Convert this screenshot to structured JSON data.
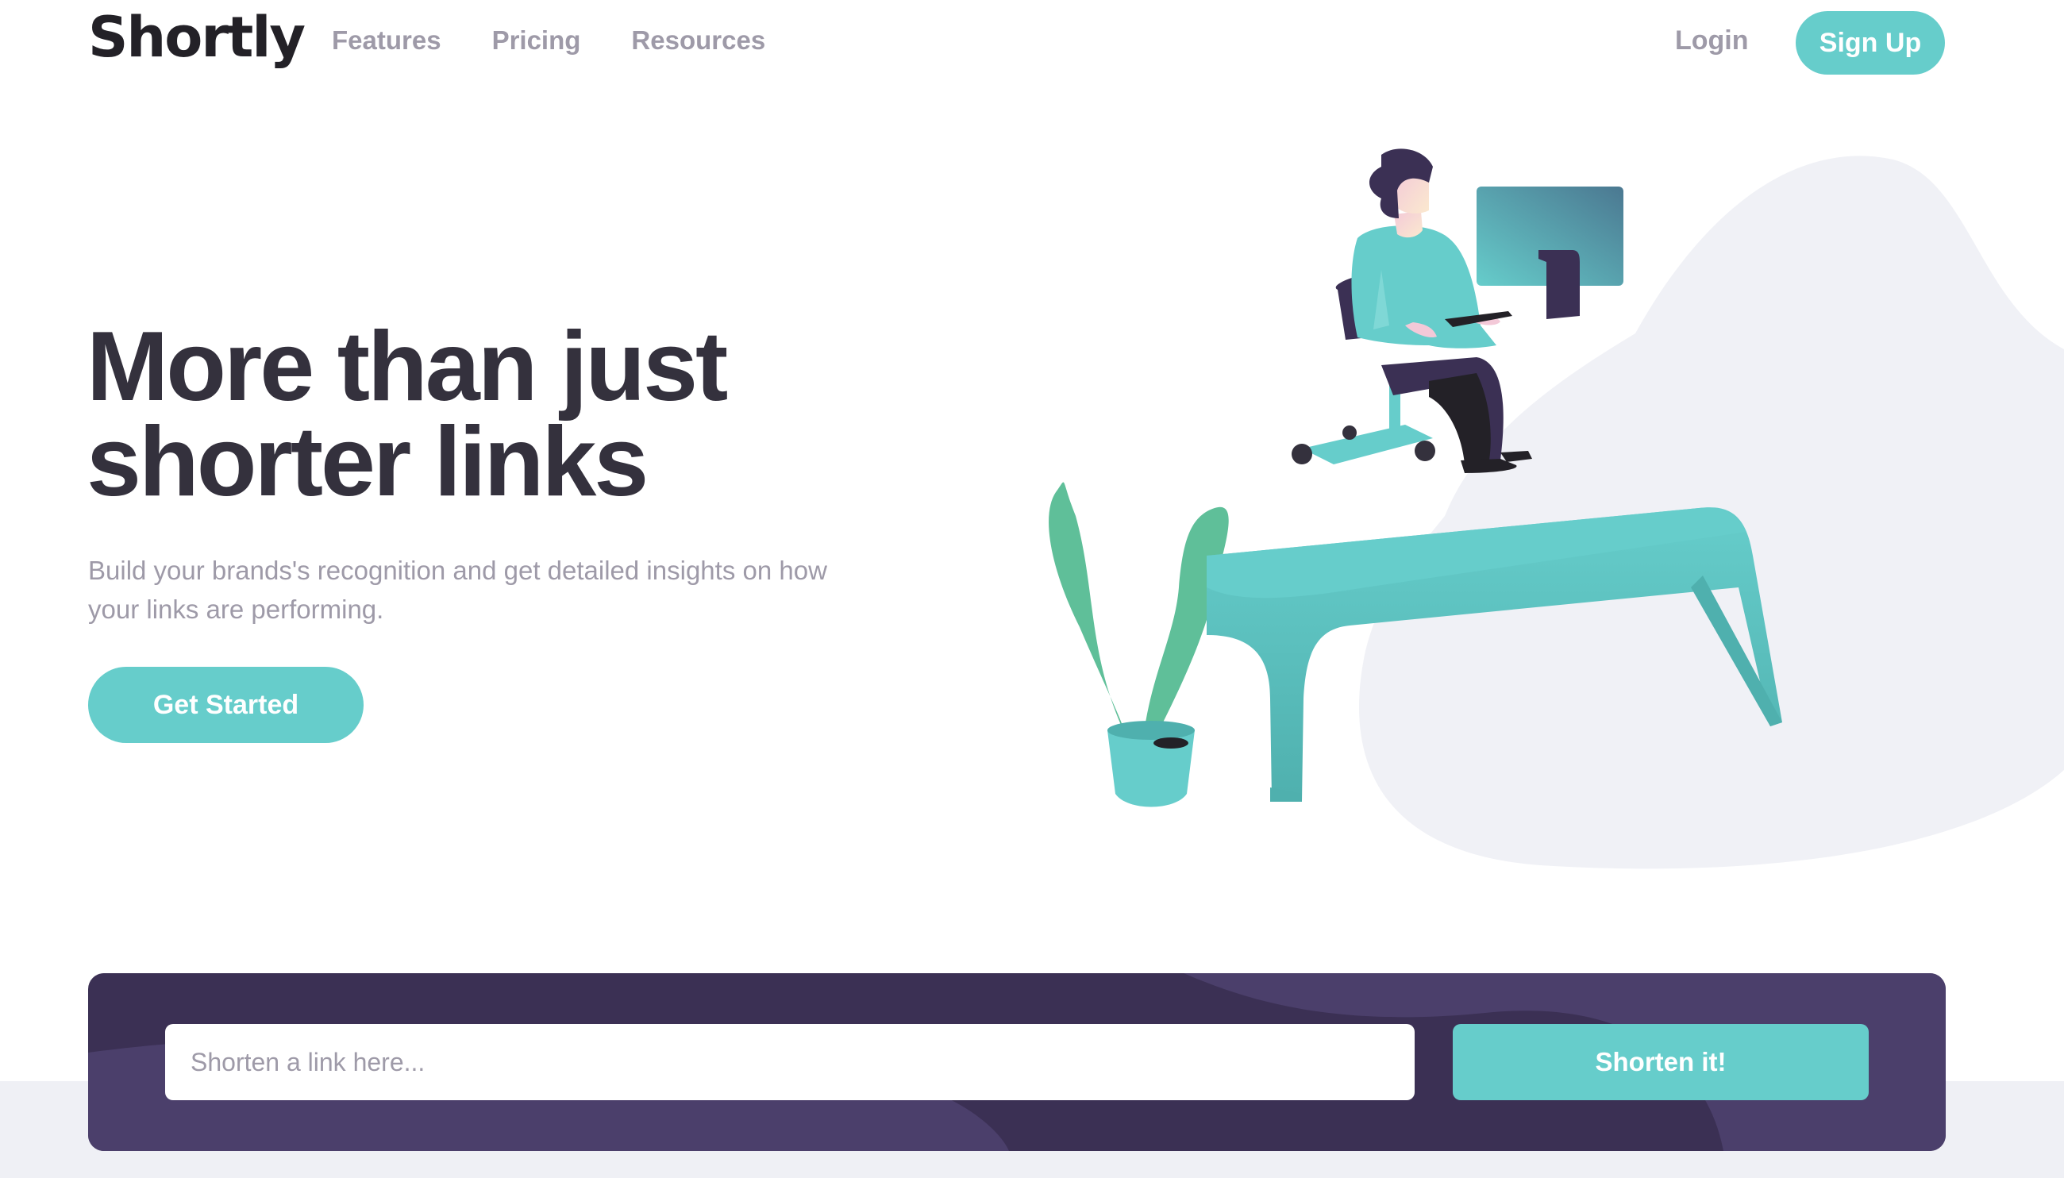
{
  "brand": {
    "name": "Shortly"
  },
  "nav": {
    "links": [
      "Features",
      "Pricing",
      "Resources"
    ],
    "login": "Login",
    "signup": "Sign Up"
  },
  "hero": {
    "title_line1": "More than just",
    "title_line2": "shorter links",
    "subtitle": "Build your brands's recognition and get detailed insights on how your links are performing.",
    "cta": "Get Started"
  },
  "shorten": {
    "placeholder": "Shorten a link here...",
    "button": "Shorten it!"
  },
  "colors": {
    "primary": "#66cdcb",
    "dark_violet": "#3b3054",
    "very_dark": "#34313d",
    "gray": "#9e9aa8",
    "light_bg": "#eff0f5"
  },
  "illustration": {
    "icon": "person-working-illustration"
  }
}
